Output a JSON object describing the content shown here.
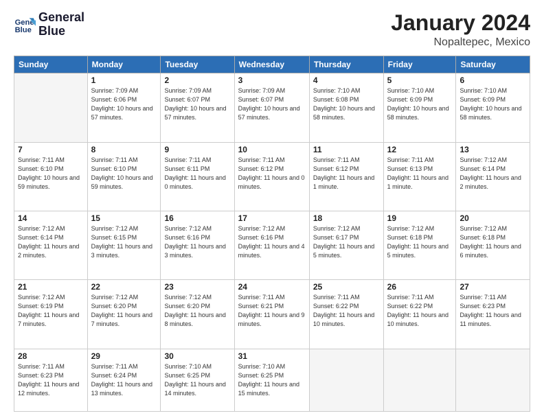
{
  "header": {
    "logo_line1": "General",
    "logo_line2": "Blue",
    "month": "January 2024",
    "location": "Nopaltepec, Mexico"
  },
  "days_of_week": [
    "Sunday",
    "Monday",
    "Tuesday",
    "Wednesday",
    "Thursday",
    "Friday",
    "Saturday"
  ],
  "weeks": [
    [
      {
        "day": "",
        "empty": true
      },
      {
        "day": "1",
        "sunrise": "Sunrise: 7:09 AM",
        "sunset": "Sunset: 6:06 PM",
        "daylight": "Daylight: 10 hours and 57 minutes."
      },
      {
        "day": "2",
        "sunrise": "Sunrise: 7:09 AM",
        "sunset": "Sunset: 6:07 PM",
        "daylight": "Daylight: 10 hours and 57 minutes."
      },
      {
        "day": "3",
        "sunrise": "Sunrise: 7:09 AM",
        "sunset": "Sunset: 6:07 PM",
        "daylight": "Daylight: 10 hours and 57 minutes."
      },
      {
        "day": "4",
        "sunrise": "Sunrise: 7:10 AM",
        "sunset": "Sunset: 6:08 PM",
        "daylight": "Daylight: 10 hours and 58 minutes."
      },
      {
        "day": "5",
        "sunrise": "Sunrise: 7:10 AM",
        "sunset": "Sunset: 6:09 PM",
        "daylight": "Daylight: 10 hours and 58 minutes."
      },
      {
        "day": "6",
        "sunrise": "Sunrise: 7:10 AM",
        "sunset": "Sunset: 6:09 PM",
        "daylight": "Daylight: 10 hours and 58 minutes."
      }
    ],
    [
      {
        "day": "7",
        "sunrise": "Sunrise: 7:11 AM",
        "sunset": "Sunset: 6:10 PM",
        "daylight": "Daylight: 10 hours and 59 minutes."
      },
      {
        "day": "8",
        "sunrise": "Sunrise: 7:11 AM",
        "sunset": "Sunset: 6:10 PM",
        "daylight": "Daylight: 10 hours and 59 minutes."
      },
      {
        "day": "9",
        "sunrise": "Sunrise: 7:11 AM",
        "sunset": "Sunset: 6:11 PM",
        "daylight": "Daylight: 11 hours and 0 minutes."
      },
      {
        "day": "10",
        "sunrise": "Sunrise: 7:11 AM",
        "sunset": "Sunset: 6:12 PM",
        "daylight": "Daylight: 11 hours and 0 minutes."
      },
      {
        "day": "11",
        "sunrise": "Sunrise: 7:11 AM",
        "sunset": "Sunset: 6:12 PM",
        "daylight": "Daylight: 11 hours and 1 minute."
      },
      {
        "day": "12",
        "sunrise": "Sunrise: 7:11 AM",
        "sunset": "Sunset: 6:13 PM",
        "daylight": "Daylight: 11 hours and 1 minute."
      },
      {
        "day": "13",
        "sunrise": "Sunrise: 7:12 AM",
        "sunset": "Sunset: 6:14 PM",
        "daylight": "Daylight: 11 hours and 2 minutes."
      }
    ],
    [
      {
        "day": "14",
        "sunrise": "Sunrise: 7:12 AM",
        "sunset": "Sunset: 6:14 PM",
        "daylight": "Daylight: 11 hours and 2 minutes."
      },
      {
        "day": "15",
        "sunrise": "Sunrise: 7:12 AM",
        "sunset": "Sunset: 6:15 PM",
        "daylight": "Daylight: 11 hours and 3 minutes."
      },
      {
        "day": "16",
        "sunrise": "Sunrise: 7:12 AM",
        "sunset": "Sunset: 6:16 PM",
        "daylight": "Daylight: 11 hours and 3 minutes."
      },
      {
        "day": "17",
        "sunrise": "Sunrise: 7:12 AM",
        "sunset": "Sunset: 6:16 PM",
        "daylight": "Daylight: 11 hours and 4 minutes."
      },
      {
        "day": "18",
        "sunrise": "Sunrise: 7:12 AM",
        "sunset": "Sunset: 6:17 PM",
        "daylight": "Daylight: 11 hours and 5 minutes."
      },
      {
        "day": "19",
        "sunrise": "Sunrise: 7:12 AM",
        "sunset": "Sunset: 6:18 PM",
        "daylight": "Daylight: 11 hours and 5 minutes."
      },
      {
        "day": "20",
        "sunrise": "Sunrise: 7:12 AM",
        "sunset": "Sunset: 6:18 PM",
        "daylight": "Daylight: 11 hours and 6 minutes."
      }
    ],
    [
      {
        "day": "21",
        "sunrise": "Sunrise: 7:12 AM",
        "sunset": "Sunset: 6:19 PM",
        "daylight": "Daylight: 11 hours and 7 minutes."
      },
      {
        "day": "22",
        "sunrise": "Sunrise: 7:12 AM",
        "sunset": "Sunset: 6:20 PM",
        "daylight": "Daylight: 11 hours and 7 minutes."
      },
      {
        "day": "23",
        "sunrise": "Sunrise: 7:12 AM",
        "sunset": "Sunset: 6:20 PM",
        "daylight": "Daylight: 11 hours and 8 minutes."
      },
      {
        "day": "24",
        "sunrise": "Sunrise: 7:11 AM",
        "sunset": "Sunset: 6:21 PM",
        "daylight": "Daylight: 11 hours and 9 minutes."
      },
      {
        "day": "25",
        "sunrise": "Sunrise: 7:11 AM",
        "sunset": "Sunset: 6:22 PM",
        "daylight": "Daylight: 11 hours and 10 minutes."
      },
      {
        "day": "26",
        "sunrise": "Sunrise: 7:11 AM",
        "sunset": "Sunset: 6:22 PM",
        "daylight": "Daylight: 11 hours and 10 minutes."
      },
      {
        "day": "27",
        "sunrise": "Sunrise: 7:11 AM",
        "sunset": "Sunset: 6:23 PM",
        "daylight": "Daylight: 11 hours and 11 minutes."
      }
    ],
    [
      {
        "day": "28",
        "sunrise": "Sunrise: 7:11 AM",
        "sunset": "Sunset: 6:23 PM",
        "daylight": "Daylight: 11 hours and 12 minutes."
      },
      {
        "day": "29",
        "sunrise": "Sunrise: 7:11 AM",
        "sunset": "Sunset: 6:24 PM",
        "daylight": "Daylight: 11 hours and 13 minutes."
      },
      {
        "day": "30",
        "sunrise": "Sunrise: 7:10 AM",
        "sunset": "Sunset: 6:25 PM",
        "daylight": "Daylight: 11 hours and 14 minutes."
      },
      {
        "day": "31",
        "sunrise": "Sunrise: 7:10 AM",
        "sunset": "Sunset: 6:25 PM",
        "daylight": "Daylight: 11 hours and 15 minutes."
      },
      {
        "day": "",
        "empty": true
      },
      {
        "day": "",
        "empty": true
      },
      {
        "day": "",
        "empty": true
      }
    ]
  ]
}
